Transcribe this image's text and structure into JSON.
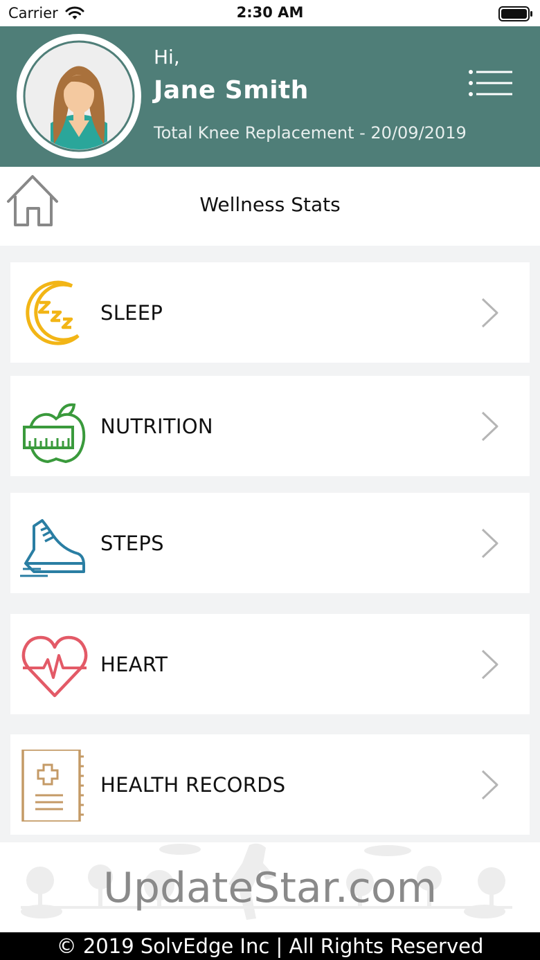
{
  "status_bar": {
    "carrier": "Carrier",
    "time": "2:30 AM"
  },
  "header": {
    "greeting": "Hi,",
    "name": "Jane Smith",
    "procedure": "Total Knee Replacement - 20/09/2019",
    "background_color": "#4f7e78"
  },
  "title_bar": {
    "title": "Wellness Stats"
  },
  "menu": [
    {
      "label": "SLEEP",
      "icon": "sleep-moon-icon",
      "color": "#f2b516"
    },
    {
      "label": "NUTRITION",
      "icon": "apple-scale-icon",
      "color": "#3a9a3c"
    },
    {
      "label": "STEPS",
      "icon": "sneaker-icon",
      "color": "#2a7ea3"
    },
    {
      "label": "HEART",
      "icon": "heart-pulse-icon",
      "color": "#e35a67"
    },
    {
      "label": "HEALTH RECORDS",
      "icon": "medical-record-icon",
      "color": "#c49a66"
    }
  ],
  "watermark": "UpdateStar.com",
  "footer": {
    "copyright": "© 2019 SolvEdge Inc | All Rights Reserved"
  }
}
